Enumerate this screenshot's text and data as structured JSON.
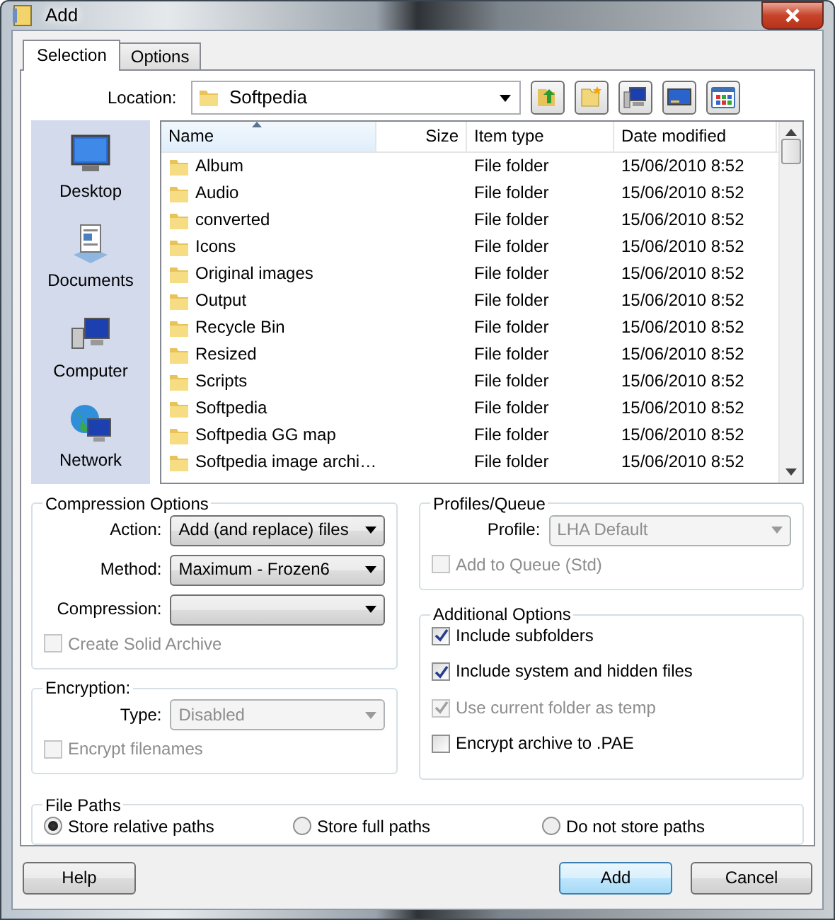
{
  "window": {
    "title": "Add"
  },
  "tabs": [
    {
      "label": "Selection",
      "selected": true
    },
    {
      "label": "Options",
      "selected": false
    }
  ],
  "location": {
    "label": "Location:",
    "value": "Softpedia"
  },
  "places": [
    {
      "label": "Desktop",
      "kind": "desktop"
    },
    {
      "label": "Documents",
      "kind": "documents"
    },
    {
      "label": "Computer",
      "kind": "computer"
    },
    {
      "label": "Network",
      "kind": "network"
    }
  ],
  "file_list": {
    "columns": [
      {
        "label": "Name",
        "sorted": true
      },
      {
        "label": "Size",
        "sorted": false
      },
      {
        "label": "Item type",
        "sorted": false
      },
      {
        "label": "Date modified",
        "sorted": false
      }
    ],
    "rows": [
      {
        "name": "Album",
        "type": "File folder",
        "date": "15/06/2010 8:52"
      },
      {
        "name": "Audio",
        "type": "File folder",
        "date": "15/06/2010 8:52"
      },
      {
        "name": "converted",
        "type": "File folder",
        "date": "15/06/2010 8:52"
      },
      {
        "name": "Icons",
        "type": "File folder",
        "date": "15/06/2010 8:52"
      },
      {
        "name": "Original images",
        "type": "File folder",
        "date": "15/06/2010 8:52"
      },
      {
        "name": "Output",
        "type": "File folder",
        "date": "15/06/2010 8:52"
      },
      {
        "name": "Recycle Bin",
        "type": "File folder",
        "date": "15/06/2010 8:52"
      },
      {
        "name": "Resized",
        "type": "File folder",
        "date": "15/06/2010 8:52"
      },
      {
        "name": "Scripts",
        "type": "File folder",
        "date": "15/06/2010 8:52"
      },
      {
        "name": "Softpedia",
        "type": "File folder",
        "date": "15/06/2010 8:52"
      },
      {
        "name": "Softpedia GG map",
        "type": "File folder",
        "date": "15/06/2010 8:52"
      },
      {
        "name": "Softpedia image archi…",
        "type": "File folder",
        "date": "15/06/2010 8:52"
      }
    ]
  },
  "compression_options": {
    "title": "Compression Options",
    "fields": [
      {
        "label": "Action:",
        "value": "Add (and replace) files",
        "disabled": false
      },
      {
        "label": "Method:",
        "value": "Maximum - Frozen6",
        "disabled": false
      },
      {
        "label": "Compression:",
        "disabled": false
      }
    ],
    "checkboxes": [
      {
        "label": "Create Solid Archive",
        "checked": false,
        "disabled": true
      }
    ]
  },
  "encryption": {
    "title": "Encryption:",
    "fields": [
      {
        "label": "Type:",
        "value": "Disabled",
        "disabled": true
      }
    ],
    "checkboxes": [
      {
        "label": "Encrypt filenames",
        "checked": false,
        "disabled": true
      }
    ]
  },
  "profiles_queue": {
    "title": "Profiles/Queue",
    "fields": [
      {
        "label": "Profile:",
        "value": "LHA Default",
        "disabled": true
      }
    ],
    "checkboxes": [
      {
        "label": "Add to Queue (Std)",
        "checked": false,
        "disabled": true
      }
    ]
  },
  "additional_options": {
    "title": "Additional Options",
    "checkboxes": [
      {
        "label": "Include subfolders",
        "checked": true,
        "disabled": false
      },
      {
        "label": "Include system and hidden files",
        "checked": true,
        "disabled": false
      },
      {
        "label": "Use current folder as temp",
        "checked": true,
        "disabled": true
      },
      {
        "label": "Encrypt archive to .PAE",
        "checked": false,
        "disabled": false
      }
    ]
  },
  "file_paths": {
    "title": "File Paths",
    "options": [
      {
        "label": "Store relative paths",
        "selected": true
      },
      {
        "label": "Store full paths",
        "selected": false
      },
      {
        "label": "Do not store paths",
        "selected": false
      }
    ]
  },
  "buttons": [
    {
      "label": "Help",
      "default": false
    },
    {
      "label": "Add",
      "default": true
    },
    {
      "label": "Cancel",
      "default": false
    }
  ]
}
